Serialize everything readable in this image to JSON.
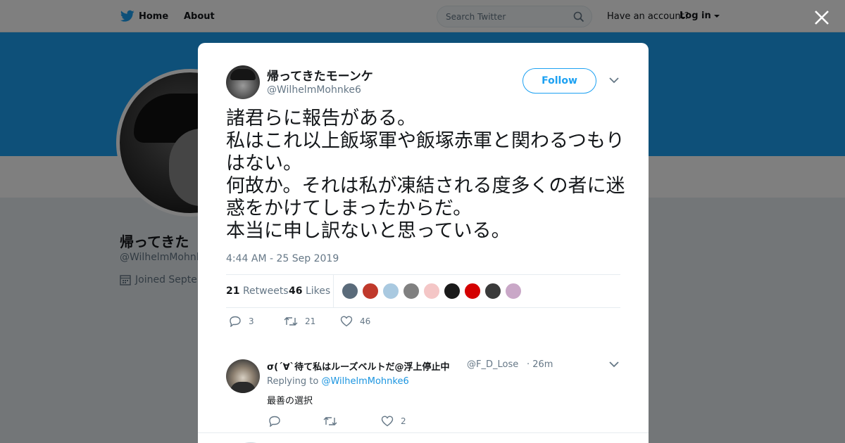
{
  "topnav": {
    "home_label": "Home",
    "about_label": "About",
    "search_placeholder": "Search Twitter",
    "have_account": "Have an account?",
    "login_label": "Log in"
  },
  "profile": {
    "name_partial": "帰ってきた",
    "handle_partial": "@WilhelmMohnke",
    "joined_partial": "Joined Septen"
  },
  "tweet": {
    "author_name": "帰ってきたモーンケ",
    "author_handle": "@WilhelmMohnke6",
    "follow_label": "Follow",
    "text": "諸君らに報告がある。\n私はこれ以上飯塚軍や飯塚赤軍と関わるつもりはない。\n何故か。それは私が凍結される度多くの者に迷惑をかけてしまったからだ。\n本当に申し訳ないと思っている。",
    "timestamp": "4:44 AM - 25 Sep 2019",
    "retweets_count": "21",
    "retweets_label": "Retweets",
    "likes_count": "46",
    "likes_label": "Likes",
    "actions": {
      "replies": "3",
      "retweets": "21",
      "likes": "46"
    }
  },
  "likers": [
    {
      "name": "liker-1",
      "color": "#5a6b7a"
    },
    {
      "name": "liker-2",
      "color": "#c0392b"
    },
    {
      "name": "liker-3",
      "color": "#a9c9e0"
    },
    {
      "name": "liker-4",
      "color": "#808080"
    },
    {
      "name": "liker-5",
      "color": "#f4c6c6"
    },
    {
      "name": "liker-6",
      "color": "#1a1a1a"
    },
    {
      "name": "liker-7",
      "color": "#d40000"
    },
    {
      "name": "liker-8",
      "color": "#3a3a3a"
    },
    {
      "name": "liker-9",
      "color": "#c9a7c7"
    }
  ],
  "reply": {
    "name": "σ(´∀`待て私はルーズベルトだ@浮上停止中",
    "handle": "@F_D_Lose",
    "time": "· 26m",
    "replying_prefix": "Replying to",
    "replying_to": "@WilhelmMohnke6",
    "text": "最善の選択",
    "actions": {
      "replies": "",
      "retweets": "",
      "likes": "2"
    }
  },
  "colors": {
    "accent": "#1da1f2",
    "text": "#14171a",
    "muted": "#657786"
  }
}
